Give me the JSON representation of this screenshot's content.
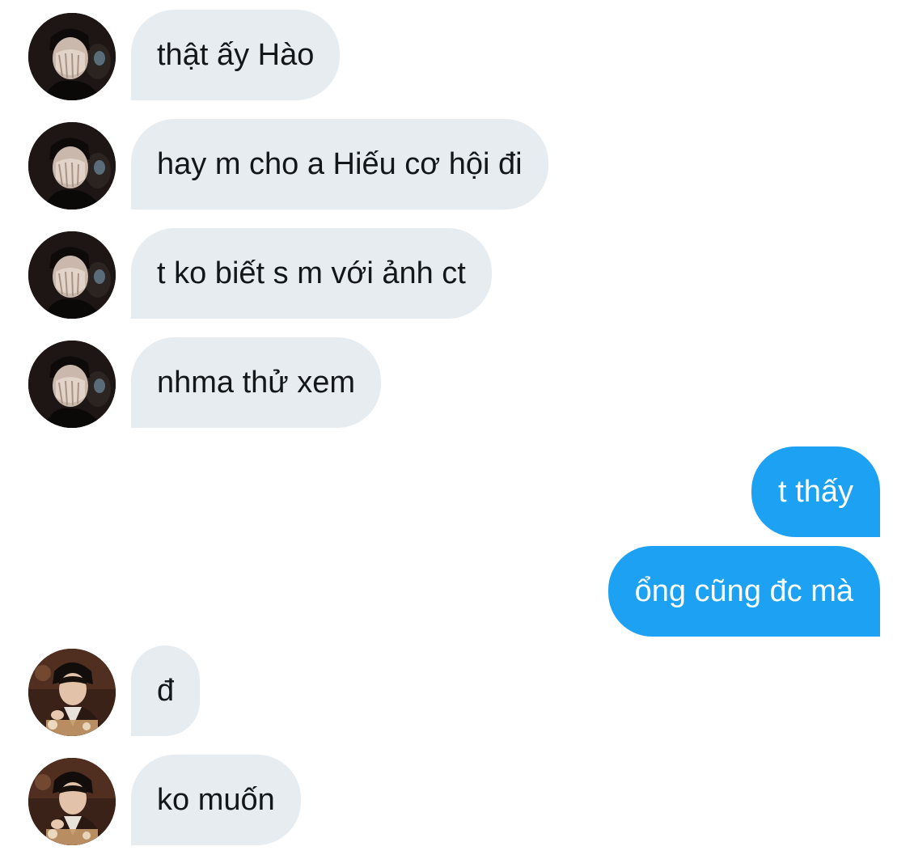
{
  "conversation": {
    "messages": [
      {
        "direction": "incoming",
        "avatar": "avatar-person-a",
        "text": "thật ấy Hào"
      },
      {
        "direction": "incoming",
        "avatar": "avatar-person-a",
        "text": "hay m cho a Hiếu cơ hội đi"
      },
      {
        "direction": "incoming",
        "avatar": "avatar-person-a",
        "text": "t ko biết s m với ảnh ct"
      },
      {
        "direction": "incoming",
        "avatar": "avatar-person-a",
        "text": "nhma thử xem"
      },
      {
        "direction": "outgoing",
        "text": "t thấy"
      },
      {
        "direction": "outgoing",
        "text": "ổng cũng đc mà"
      },
      {
        "direction": "incoming",
        "avatar": "avatar-person-b",
        "text": "đ"
      },
      {
        "direction": "incoming",
        "avatar": "avatar-person-b",
        "text": "ko muốn"
      }
    ]
  },
  "colors": {
    "incoming_bubble": "#e6ecf0",
    "incoming_text": "#14171a",
    "outgoing_bubble": "#1da1f2",
    "outgoing_text": "#ffffff",
    "background": "#ffffff"
  }
}
